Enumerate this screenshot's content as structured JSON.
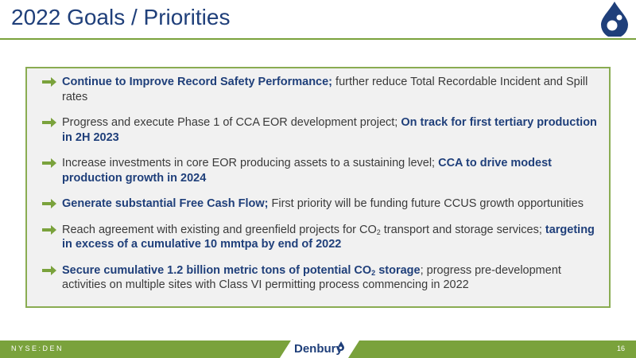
{
  "header": {
    "title": "2022 Goals / Priorities"
  },
  "goals": [
    {
      "highlight": "Continue to Improve Record Safety Performance;",
      "text": " further reduce Total Recordable Incident and Spill rates"
    },
    {
      "text": "Progress and execute Phase 1 of CCA EOR development project; ",
      "highlight": "On track for first tertiary production in 2H 2023"
    },
    {
      "text": "Increase investments in core EOR producing assets to a sustaining level; ",
      "highlight": "CCA to drive modest production growth in 2024"
    },
    {
      "highlight": "Generate substantial Free Cash Flow;",
      "text": " First priority will be funding future CCUS growth opportunities"
    },
    {
      "text_a": "Reach agreement with existing and greenfield projects for CO",
      "sub": "2",
      "text_b": " transport and storage services; ",
      "highlight": "targeting in excess of a cumulative 10 mmtpa by end of 2022"
    },
    {
      "highlight_a": "Secure cumulative 1.2 billion metric tons of potential CO",
      "sub": "2",
      "highlight_b": " storage",
      "text": "; progress pre-development activities on multiple sites with Class VI permitting process commencing in 2022"
    }
  ],
  "footer": {
    "ticker": "NYSE:DEN",
    "brand": "Denbury",
    "page_number": "16"
  },
  "colors": {
    "navy": "#1f3f7a",
    "green": "#7aa23c",
    "panel_bg": "#f1f1f1",
    "body_text": "#3a3a3a"
  },
  "icons": [
    "company-logo-icon",
    "right-arrow-icon",
    "drop-icon"
  ]
}
